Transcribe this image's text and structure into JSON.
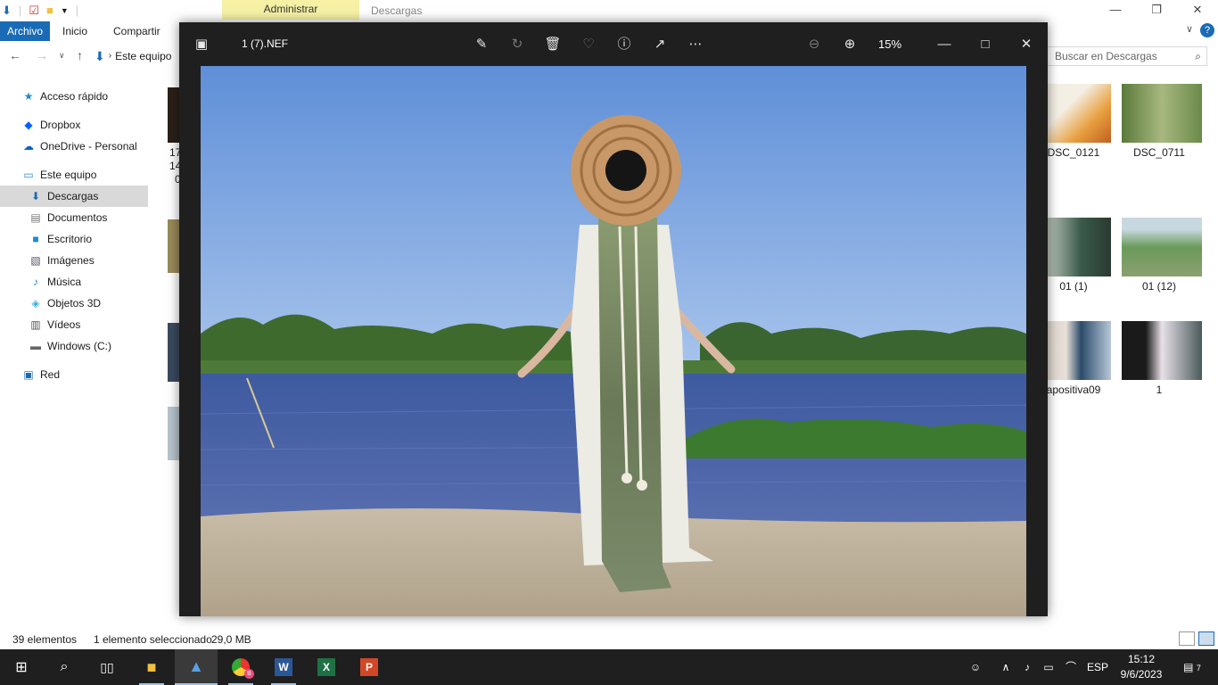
{
  "explorer": {
    "context_tab": "Administrar",
    "window_title": "Descargas",
    "ribbon_tabs": [
      "Archivo",
      "Inicio",
      "Compartir"
    ],
    "address": "Este equipo",
    "search_placeholder": "Buscar en Descargas",
    "sidebar": [
      {
        "label": "Acceso rápido",
        "icon": "star-icon",
        "indent": false,
        "selected": false
      },
      {
        "label": "Dropbox",
        "icon": "dropbox-icon",
        "indent": false,
        "selected": false
      },
      {
        "label": "OneDrive - Personal",
        "icon": "cloud-icon",
        "indent": false,
        "selected": false
      },
      {
        "label": "Este equipo",
        "icon": "computer-icon",
        "indent": false,
        "selected": false
      },
      {
        "label": "Descargas",
        "icon": "download-icon",
        "indent": true,
        "selected": true
      },
      {
        "label": "Documentos",
        "icon": "document-icon",
        "indent": true,
        "selected": false
      },
      {
        "label": "Escritorio",
        "icon": "desktop-icon",
        "indent": true,
        "selected": false
      },
      {
        "label": "Imágenes",
        "icon": "image-icon",
        "indent": true,
        "selected": false
      },
      {
        "label": "Música",
        "icon": "music-icon",
        "indent": true,
        "selected": false
      },
      {
        "label": "Objetos 3D",
        "icon": "cube-icon",
        "indent": true,
        "selected": false
      },
      {
        "label": "Vídeos",
        "icon": "film-icon",
        "indent": true,
        "selected": false
      },
      {
        "label": "Windows (C:)",
        "icon": "drive-icon",
        "indent": true,
        "selected": false
      },
      {
        "label": "Red",
        "icon": "network-icon",
        "indent": false,
        "selected": false
      }
    ],
    "left_fragment_labels": [
      "17",
      "14",
      "0"
    ],
    "files": [
      {
        "label": "DSC_0121"
      },
      {
        "label": "DSC_0711"
      },
      {
        "label": "01 (1)"
      },
      {
        "label": "01 (12)"
      },
      {
        "label": "apositiva09"
      },
      {
        "label": "1"
      }
    ],
    "status": {
      "count": "39 elementos",
      "selected": "1 elemento seleccionado",
      "size": "29,0 MB"
    }
  },
  "viewer": {
    "file_name": "1 (7).NEF",
    "zoom": "15%"
  },
  "taskbar": {
    "language": "ESP",
    "time": "15:12",
    "date": "9/6/2023",
    "notifications": "7",
    "chrome_badge": "B"
  }
}
